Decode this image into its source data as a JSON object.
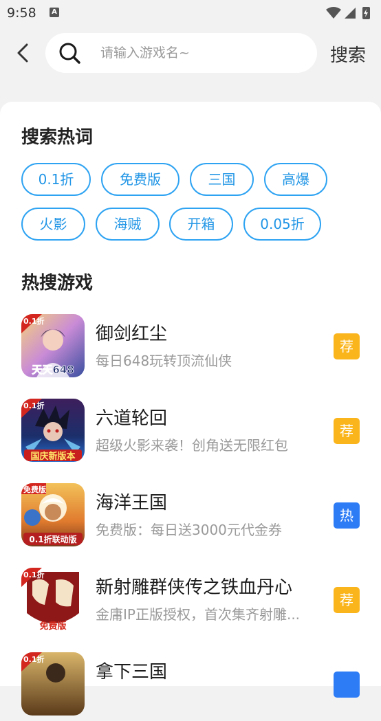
{
  "status_bar": {
    "time": "9:58"
  },
  "header": {
    "search_placeholder": "请输入游戏名~",
    "search_button": "搜索"
  },
  "hot_words": {
    "title": "搜索热词",
    "items": [
      "0.1折",
      "免费版",
      "三国",
      "高爆",
      "火影",
      "海贼",
      "开箱",
      "0.05折"
    ]
  },
  "hot_games": {
    "title": "热搜游戏",
    "items": [
      {
        "name": "御剑红尘",
        "desc": "每日648玩转顶流仙侠",
        "badge": "荐",
        "badge_color": "#fbb51c",
        "icon_tag": "0.1折",
        "icon_caption": "天天648"
      },
      {
        "name": "六道轮回",
        "desc": "超级火影来袭！创角送无限红包",
        "badge": "荐",
        "badge_color": "#fbb51c",
        "icon_tag": "0.1折",
        "icon_caption": "国庆新版本"
      },
      {
        "name": "海洋王国",
        "desc": "免费版：每日送3000元代金券",
        "badge": "热",
        "badge_color": "#2d7cf6",
        "icon_tag": "免费版",
        "icon_caption": "0.1折联动版"
      },
      {
        "name": "新射雕群侠传之铁血丹心",
        "desc": "金庸IP正版授权，首次集齐射雕...",
        "badge": "荐",
        "badge_color": "#fbb51c",
        "icon_tag": "0.1折",
        "icon_caption": "免费版"
      },
      {
        "name": "拿下三国",
        "desc": "",
        "badge": "",
        "badge_color": "#2d7cf6",
        "icon_tag": "0.1折",
        "icon_caption": ""
      }
    ]
  }
}
